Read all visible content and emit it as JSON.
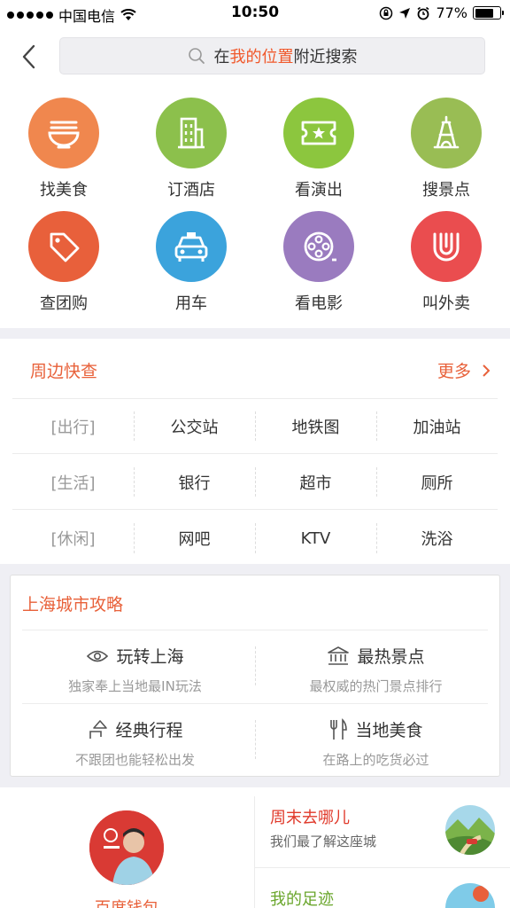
{
  "status_bar": {
    "carrier": "中国电信",
    "time": "10:50",
    "battery": "77%",
    "battery_level": 0.77
  },
  "header": {
    "search_prefix": "在",
    "search_highlight": "我的位置",
    "search_suffix": "附近搜索"
  },
  "categories": [
    {
      "label": "找美食",
      "color": "#f0874e",
      "icon": "noodle-bowl-icon"
    },
    {
      "label": "订酒店",
      "color": "#8cc04c",
      "icon": "building-icon"
    },
    {
      "label": "看演出",
      "color": "#8cc63e",
      "icon": "ticket-icon"
    },
    {
      "label": "搜景点",
      "color": "#99bd54",
      "icon": "tower-icon"
    },
    {
      "label": "查团购",
      "color": "#e8603b",
      "icon": "tag-icon"
    },
    {
      "label": "用车",
      "color": "#3ba3dc",
      "icon": "taxi-icon"
    },
    {
      "label": "看电影",
      "color": "#9a7bbf",
      "icon": "film-reel-icon"
    },
    {
      "label": "叫外卖",
      "color": "#ea4d4f",
      "icon": "takeout-icon"
    }
  ],
  "nearby": {
    "title": "周边快查",
    "more": "更多",
    "rows": [
      {
        "category": "[出行]",
        "items": [
          "公交站",
          "地铁图",
          "加油站"
        ]
      },
      {
        "category": "[生活]",
        "items": [
          "银行",
          "超市",
          "厕所"
        ]
      },
      {
        "category": "[休闲]",
        "items": [
          "网吧",
          "KTV",
          "洗浴"
        ]
      }
    ]
  },
  "city_guide": {
    "title": "上海城市攻略",
    "items": [
      {
        "title": "玩转上海",
        "subtitle": "独家奉上当地最IN玩法",
        "icon": "eye-icon"
      },
      {
        "title": "最热景点",
        "subtitle": "最权威的热门景点排行",
        "icon": "landmark-icon"
      },
      {
        "title": "经典行程",
        "subtitle": "不跟团也能轻松出发",
        "icon": "route-icon"
      },
      {
        "title": "当地美食",
        "subtitle": "在路上的吃货必过",
        "icon": "fork-knife-icon"
      }
    ]
  },
  "bottom": {
    "wallet_label": "百度钱包",
    "weekend_title": "周末去哪儿",
    "weekend_subtitle": "我们最了解这座城",
    "footprint_title": "我的足迹"
  }
}
